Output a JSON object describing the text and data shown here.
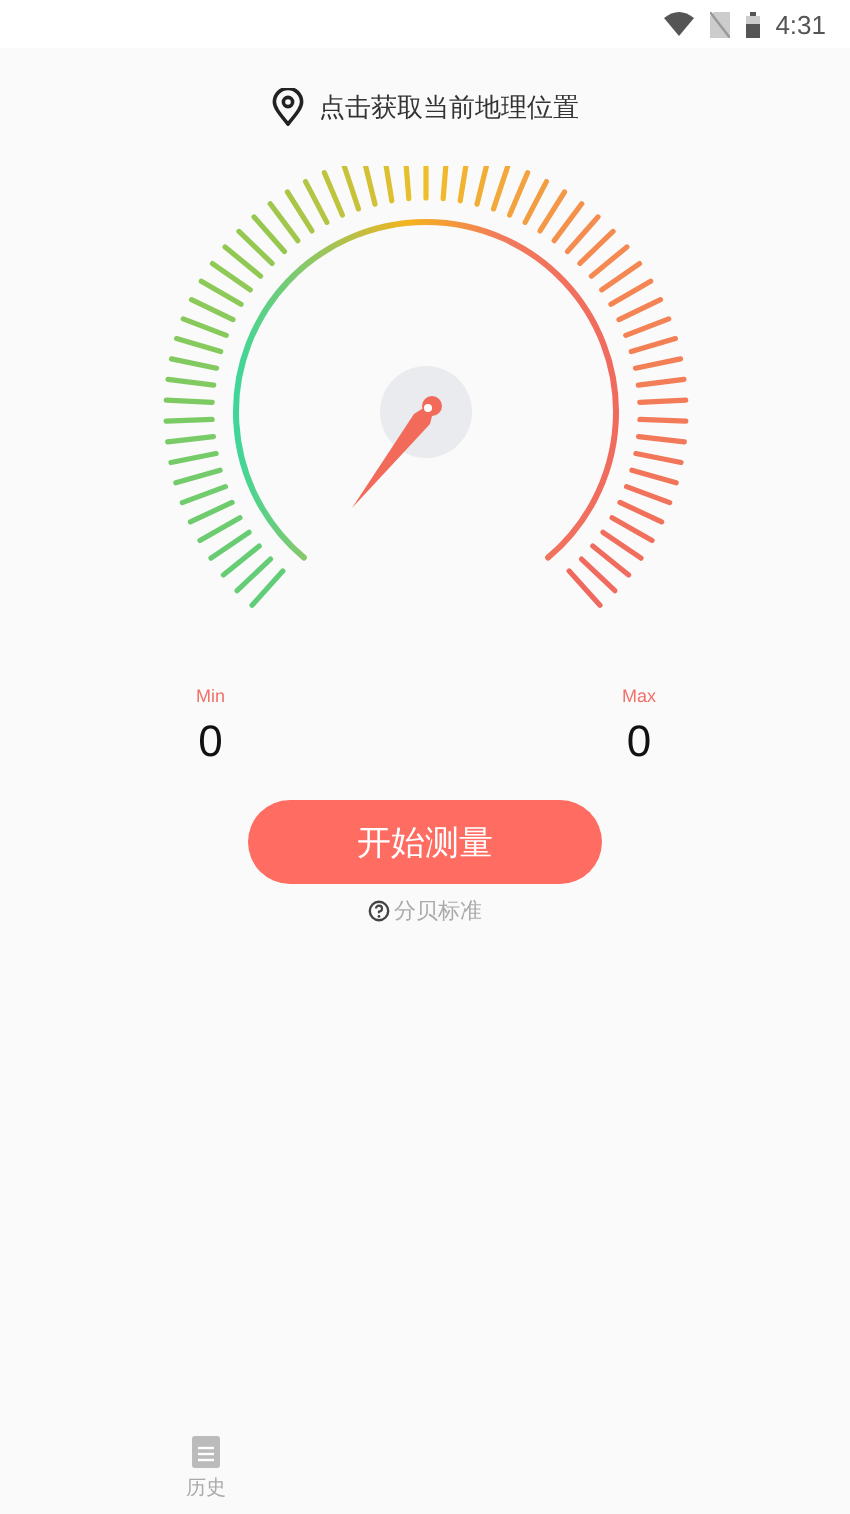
{
  "status_bar": {
    "time": "4:31"
  },
  "location": {
    "label": "点击获取当前地理位置"
  },
  "readings": [
    {
      "label": "Min",
      "value": "0"
    },
    {
      "label": "Max",
      "value": "0"
    }
  ],
  "start_button": {
    "label": "开始测量"
  },
  "help_link": {
    "label": "分贝标准"
  },
  "bottom_nav": [
    {
      "label": "历史",
      "selected": false
    }
  ]
}
